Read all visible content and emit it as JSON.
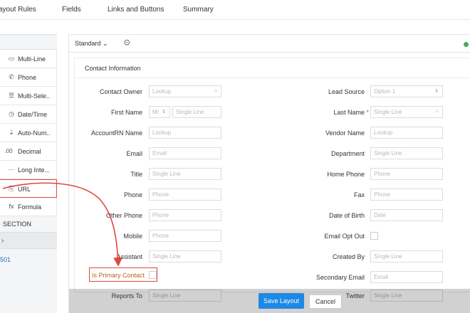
{
  "topnav": {
    "tabs": [
      "ayout Rules",
      "Fields",
      "Links and Buttons",
      "Summary"
    ]
  },
  "palette": {
    "items": [
      {
        "icon": "▭",
        "label": "Multi-Line"
      },
      {
        "icon": "✆",
        "label": "Phone"
      },
      {
        "icon": "☰",
        "label": "Multi-Sele.."
      },
      {
        "icon": "◷",
        "label": "Date/Time"
      },
      {
        "icon": "⇣",
        "label": "Auto-Num.."
      },
      {
        "icon": ".00",
        "label": "Decimal"
      },
      {
        "icon": "⋯",
        "label": "Long Inte..."
      },
      {
        "icon": "⎘",
        "label": "URL"
      },
      {
        "icon": "fx",
        "label": "Formula"
      }
    ],
    "section_label": "SECTION",
    "section_chevron": "›",
    "footer_text": "501"
  },
  "toolbar": {
    "layout_name": "Standard",
    "dropdown_caret": "⌄"
  },
  "section": {
    "title": "Contact Information"
  },
  "left_fields": [
    {
      "label": "Contact Owner",
      "placeholder": "Lookup",
      "icon": "⌂"
    },
    {
      "label": "First Name",
      "salutation": "Mr.",
      "placeholder": "Single Line"
    },
    {
      "label": "AccountRN Name",
      "placeholder": "Lookup"
    },
    {
      "label": "Email",
      "placeholder": "Email"
    },
    {
      "label": "Title",
      "placeholder": "Single Line"
    },
    {
      "label": "Phone",
      "placeholder": "Phone"
    },
    {
      "label": "Other Phone",
      "placeholder": "Phone"
    },
    {
      "label": "Mobile",
      "placeholder": "Phone"
    },
    {
      "label": "Assistant",
      "placeholder": "Single Line"
    },
    {
      "label": "Is Primary Contact"
    },
    {
      "label": "Reports To",
      "placeholder": "Single Line"
    }
  ],
  "right_fields": [
    {
      "label": "Lead Source",
      "placeholder": "Option 1"
    },
    {
      "label": "Last Name",
      "required": "*",
      "placeholder": "Single Line",
      "icon": "⌂"
    },
    {
      "label": "Vendor Name",
      "placeholder": "Lookup"
    },
    {
      "label": "Department",
      "placeholder": "Single Line"
    },
    {
      "label": "Home Phone",
      "placeholder": "Phone"
    },
    {
      "label": "Fax",
      "placeholder": "Phone"
    },
    {
      "label": "Date of Birth",
      "placeholder": "Date"
    },
    {
      "label": "Email Opt Out"
    },
    {
      "label": "Created By",
      "placeholder": "Single Line"
    },
    {
      "label": "Secondary Email",
      "placeholder": "Email"
    },
    {
      "label": "Twitter",
      "placeholder": "Single Line"
    }
  ],
  "footer": {
    "save_label": "Save Layout",
    "cancel_label": "Cancel"
  },
  "colors": {
    "accent": "#1e88e5",
    "highlight": "#e0473c",
    "status_dot": "#3fb15a"
  }
}
